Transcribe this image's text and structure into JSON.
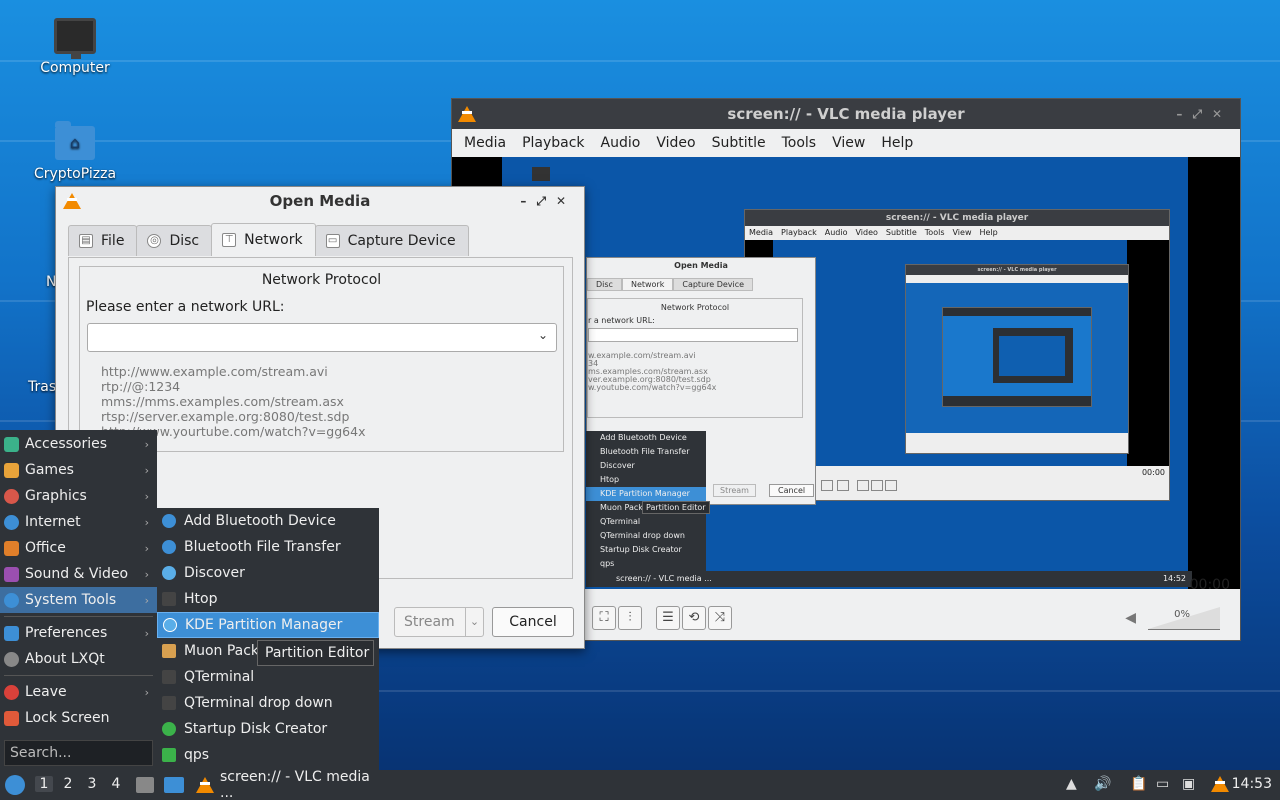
{
  "desktop": {
    "icons": [
      {
        "label": "Computer",
        "icon": "monitor-icon"
      },
      {
        "label": "CryptoPizza",
        "icon": "home-folder-icon"
      }
    ],
    "partial_labels": [
      "N",
      "Tras"
    ]
  },
  "vlc": {
    "title": "screen:// - VLC media player",
    "menu": [
      "Media",
      "Playback",
      "Audio",
      "Video",
      "Subtitle",
      "Tools",
      "View",
      "Help"
    ],
    "time": "00:00",
    "volume": "0%",
    "nested_time": "00:00",
    "nested_clock": "14:52",
    "nested_task": "screen:// - VLC media ...",
    "nested_menu_items": [
      "Add Bluetooth Device",
      "Bluetooth File Transfer",
      "Discover",
      "Htop",
      "KDE Partition Manager",
      "Muon Pack",
      "QTerminal",
      "QTerminal drop down",
      "Startup Disk Creator",
      "qps"
    ],
    "nested_tooltip": "Partition Editor",
    "nested_dialog": {
      "title": "Open Media",
      "tabs": [
        "Disc",
        "Network",
        "Capture Device"
      ],
      "group_title": "Network Protocol",
      "url_label": "r a network URL:",
      "examples": [
        "w.example.com/stream.avi",
        "34",
        "ms.examples.com/stream.asx",
        "ver.example.org:8080/test.sdp",
        "w.youtube.com/watch?v=gg64x"
      ],
      "stream": "Stream",
      "cancel": "Cancel"
    }
  },
  "dialog": {
    "title": "Open Media",
    "tabs": [
      {
        "label": "File",
        "icon": "file-icon"
      },
      {
        "label": "Disc",
        "icon": "disc-icon"
      },
      {
        "label": "Network",
        "icon": "network-icon",
        "active": true
      },
      {
        "label": "Capture Device",
        "icon": "capture-device-icon"
      }
    ],
    "group_title": "Network Protocol",
    "url_label": "Please enter a network URL:",
    "url_value": "",
    "examples": [
      "http://www.example.com/stream.avi",
      "rtp://@:1234",
      "mms://mms.examples.com/stream.asx",
      "rtsp://server.example.org:8080/test.sdp",
      "http://www.yourtube.com/watch?v=gg64x"
    ],
    "stream_label": "Stream",
    "cancel_label": "Cancel"
  },
  "start_menu": {
    "items": [
      {
        "label": "Accessories",
        "icon": "accessories-icon",
        "color": "#3bb28a",
        "submenu": true
      },
      {
        "label": "Games",
        "icon": "games-icon",
        "color": "#e8a33a",
        "submenu": true
      },
      {
        "label": "Graphics",
        "icon": "graphics-icon",
        "color": "#d8574a",
        "submenu": true
      },
      {
        "label": "Internet",
        "icon": "internet-icon",
        "color": "#3d8fd6",
        "submenu": true
      },
      {
        "label": "Office",
        "icon": "office-icon",
        "color": "#e07f2a",
        "submenu": true
      },
      {
        "label": "Sound & Video",
        "icon": "sound-video-icon",
        "color": "#9b4fb0",
        "submenu": true
      },
      {
        "label": "System Tools",
        "icon": "system-tools-icon",
        "color": "#3d8fd6",
        "submenu": true,
        "active": true
      },
      {
        "label": "Preferences",
        "icon": "preferences-icon",
        "color": "#3d8fd6",
        "submenu": true
      },
      {
        "label": "About LXQt",
        "icon": "about-icon",
        "color": "#888888",
        "submenu": false
      },
      {
        "label": "Leave",
        "icon": "leave-icon",
        "color": "#d9413a",
        "submenu": true
      },
      {
        "label": "Lock Screen",
        "icon": "lock-icon",
        "color": "#e05a3a",
        "submenu": false
      }
    ],
    "search_placeholder": "Search..."
  },
  "system_tools": {
    "items": [
      {
        "label": "Add Bluetooth Device",
        "icon": "bluetooth-icon",
        "color": "#3d8fd6"
      },
      {
        "label": "Bluetooth File Transfer",
        "icon": "bluetooth-icon",
        "color": "#3d8fd6"
      },
      {
        "label": "Discover",
        "icon": "discover-icon",
        "color": "#5aaee8"
      },
      {
        "label": "Htop",
        "icon": "htop-icon",
        "color": "#444444"
      },
      {
        "label": "KDE Partition Manager",
        "icon": "partition-manager-icon",
        "color": "#5aaee8",
        "active": true
      },
      {
        "label": "Muon Pack",
        "icon": "muon-icon",
        "color": "#d8a050"
      },
      {
        "label": "QTerminal",
        "icon": "terminal-icon",
        "color": "#444444"
      },
      {
        "label": "QTerminal drop down",
        "icon": "terminal-icon",
        "color": "#444444"
      },
      {
        "label": "Startup Disk Creator",
        "icon": "startup-disk-icon",
        "color": "#3bb24a"
      },
      {
        "label": "qps",
        "icon": "qps-icon",
        "color": "#3bb24a"
      }
    ],
    "tooltip": "Partition Editor"
  },
  "taskbar": {
    "desktops": [
      "1",
      "2",
      "3",
      "4"
    ],
    "task_label": "screen:// - VLC media ...",
    "clock": "14:53"
  }
}
